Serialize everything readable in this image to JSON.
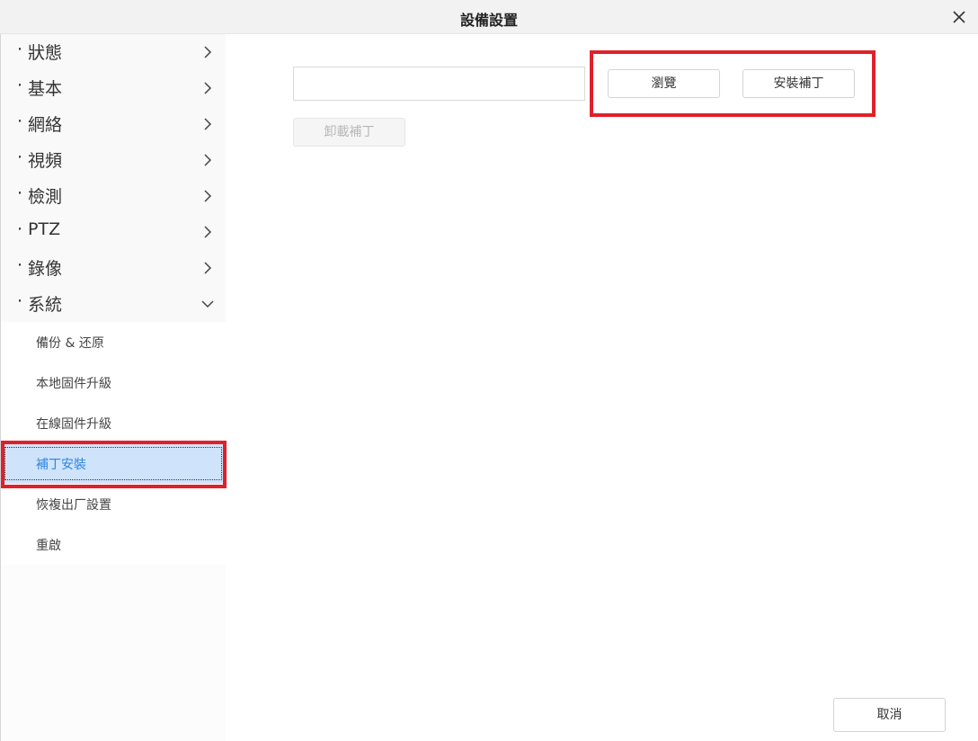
{
  "window": {
    "title": "設備設置",
    "close_icon": "close-icon"
  },
  "sidebar": {
    "items": [
      {
        "label": "狀態",
        "expanded": false
      },
      {
        "label": "基本",
        "expanded": false
      },
      {
        "label": "網絡",
        "expanded": false
      },
      {
        "label": "視頻",
        "expanded": false
      },
      {
        "label": "檢測",
        "expanded": false
      },
      {
        "label": "PTZ",
        "expanded": false
      },
      {
        "label": "錄像",
        "expanded": false
      },
      {
        "label": "系統",
        "expanded": true
      }
    ],
    "bullet": "·",
    "sub_items": [
      {
        "label": "備份 & 还原"
      },
      {
        "label": "本地固件升級"
      },
      {
        "label": "在線固件升級"
      },
      {
        "label": "補丁安裝",
        "active": true
      },
      {
        "label": "恢複出厂設置"
      },
      {
        "label": "重啟"
      }
    ]
  },
  "main": {
    "file_path_value": "",
    "browse_label": "瀏覽",
    "install_label": "安裝補丁",
    "uninstall_label": "卸載補丁"
  },
  "footer": {
    "cancel_label": "取消"
  },
  "colors": {
    "active_bg": "#cfe3fb",
    "active_text": "#2f86e0",
    "highlight": "#e0202a"
  }
}
